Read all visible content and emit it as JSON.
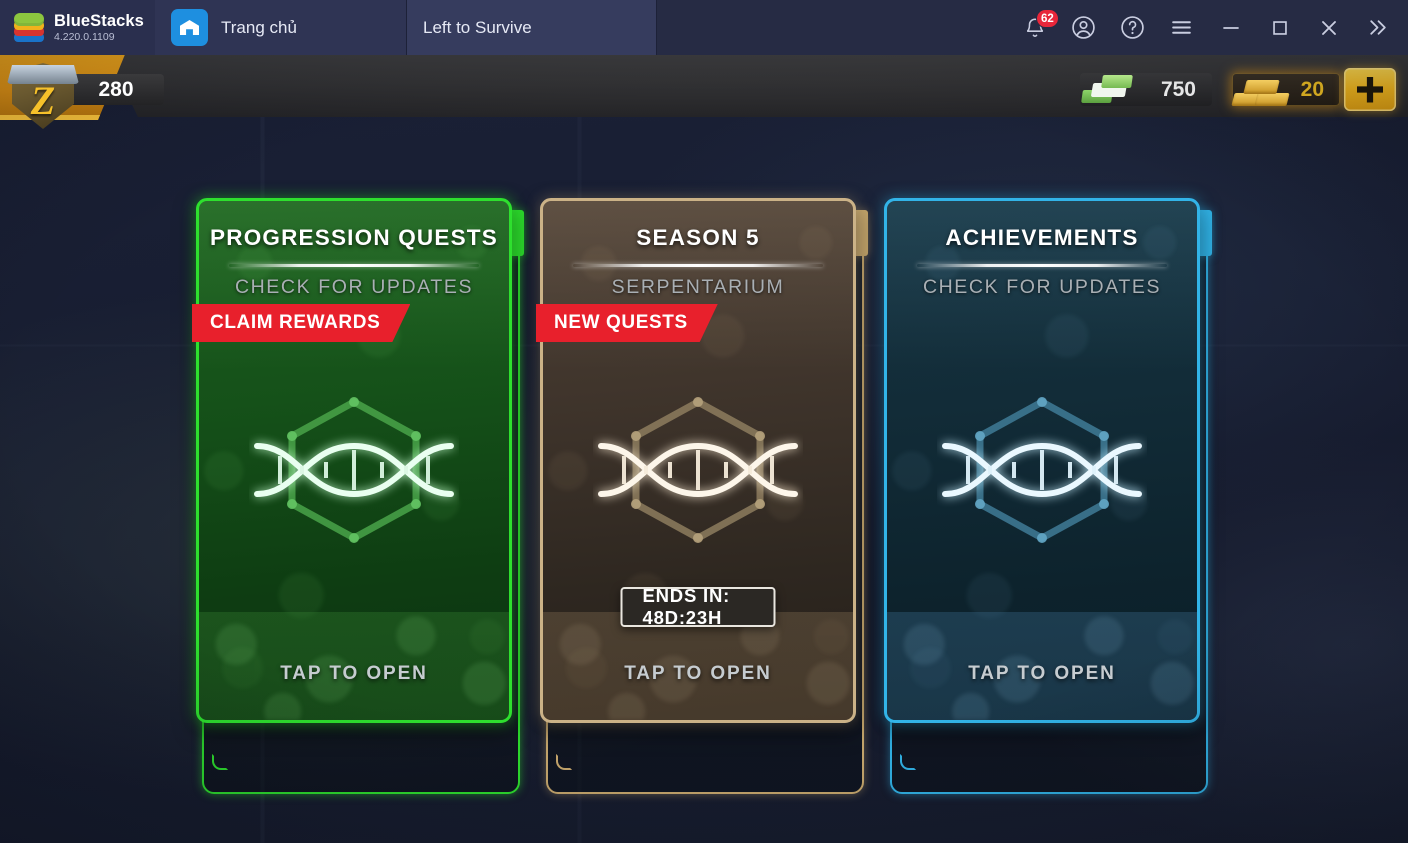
{
  "titlebar": {
    "brand_name": "BlueStacks",
    "version": "4.220.0.1109",
    "tabs": [
      {
        "label": "Trang chủ",
        "icon": "home-icon",
        "active": false
      },
      {
        "label": "Left to Survive",
        "icon": "game-thumbnail-icon",
        "active": true
      }
    ],
    "actions": [
      {
        "name": "notifications-button",
        "icon": "bell-icon",
        "badge": "62"
      },
      {
        "name": "account-button",
        "icon": "user-circle-icon"
      },
      {
        "name": "help-button",
        "icon": "question-circle-icon"
      },
      {
        "name": "menu-button",
        "icon": "hamburger-icon"
      },
      {
        "name": "minimize-button",
        "icon": "minimize-icon"
      },
      {
        "name": "maximize-button",
        "icon": "maximize-icon"
      },
      {
        "name": "close-button",
        "icon": "close-icon"
      },
      {
        "name": "expand-button",
        "icon": "double-chevron-right-icon"
      }
    ]
  },
  "hud": {
    "player_level": "280",
    "level_badge_icon": "z-shield-icon",
    "cash": {
      "icon": "cash-stack-icon",
      "value": "750"
    },
    "gold": {
      "icon": "gold-bars-icon",
      "value": "20"
    },
    "add_button": {
      "icon": "plus-icon",
      "label": "+"
    }
  },
  "cards": [
    {
      "id": "progression-quests",
      "title": "PROGRESSION QUESTS",
      "subtitle": "CHECK FOR UPDATES",
      "ribbon": "CLAIM REWARDS",
      "timer": null,
      "footer": "TAP TO OPEN",
      "icon": "dna-helix-icon",
      "accent": "#2ee02e",
      "theme": "green"
    },
    {
      "id": "season-5",
      "title": "SEASON 5",
      "subtitle": "SERPENTARIUM",
      "ribbon": "NEW QUESTS",
      "timer": "ENDS IN: 48D:23H",
      "footer": "TAP TO OPEN",
      "icon": "dna-helix-icon",
      "accent": "#d8b87c",
      "theme": "tan"
    },
    {
      "id": "achievements",
      "title": "ACHIEVEMENTS",
      "subtitle": "CHECK FOR UPDATES",
      "ribbon": null,
      "timer": null,
      "footer": "TAP TO OPEN",
      "icon": "dna-helix-icon",
      "accent": "#32b4e8",
      "theme": "blue"
    }
  ],
  "colors": {
    "titlebar_bg": "#262b44",
    "active_tab_bg": "#363c5e",
    "badge_red": "#e8263a",
    "ribbon_red": "#e8202c",
    "gold": "#f3c223",
    "green_accent": "#2ee02e",
    "tan_accent": "#d8b87c",
    "blue_accent": "#32b4e8"
  }
}
